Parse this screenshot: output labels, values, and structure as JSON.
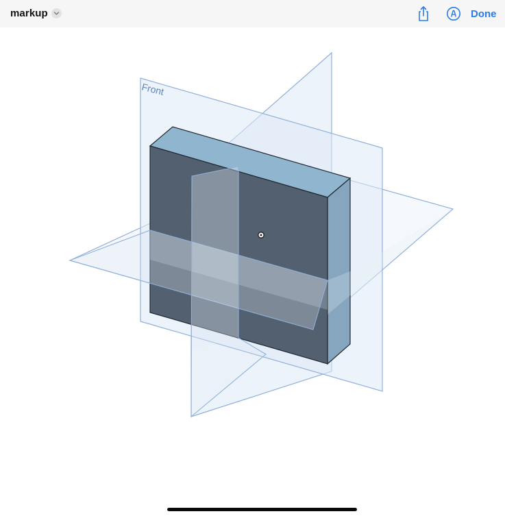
{
  "header": {
    "document_title": "markup",
    "done_label": "Done",
    "icons": {
      "title_menu": "chevron-down-icon",
      "share": "share-icon",
      "markup": "markup-pen-icon"
    }
  },
  "viewport": {
    "plane_labels": {
      "front": "Front"
    },
    "colors": {
      "accent": "#2a7be4",
      "plane_fill": "#dfe9f6",
      "plane_stroke": "#8fb0d9",
      "box_front": "#53606f",
      "box_top": "#90b5cf",
      "box_side": "#86a6c0"
    }
  }
}
